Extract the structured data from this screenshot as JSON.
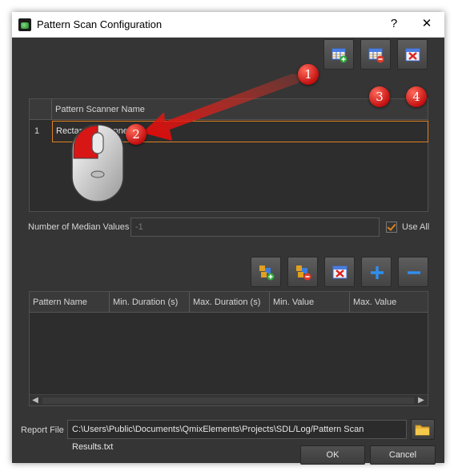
{
  "window": {
    "title": "Pattern Scan Configuration",
    "help_glyph": "?",
    "close_glyph": "✕"
  },
  "scanner_toolbar": [
    {
      "icon": "add-scanner-icon"
    },
    {
      "icon": "remove-scanner-icon"
    },
    {
      "icon": "clear-scanners-icon"
    }
  ],
  "scanner_table": {
    "column_header": "Pattern Scanner Name",
    "rows": [
      {
        "num": "1",
        "name": "Rectangle Scanner"
      }
    ]
  },
  "median": {
    "label": "Number of Median Values",
    "placeholder": "-1",
    "use_all_label": "Use All",
    "use_all_checked": true
  },
  "pattern_toolbar": [
    {
      "icon": "add-pattern-icon"
    },
    {
      "icon": "remove-pattern-icon"
    },
    {
      "icon": "clear-patterns-icon"
    },
    {
      "icon": "plus-icon"
    },
    {
      "icon": "minus-icon"
    }
  ],
  "pattern_table": {
    "headers": [
      "Pattern Name",
      "Min. Duration (s)",
      "Max. Duration (s)",
      "Min. Value",
      "Max. Value"
    ]
  },
  "report": {
    "label": "Report File",
    "path": "C:\\Users\\Public\\Documents\\QmixElements\\Projects\\SDL/Log/Pattern Scan Results.txt"
  },
  "buttons": {
    "ok": "OK",
    "cancel": "Cancel"
  },
  "annotations": {
    "badges": [
      "1",
      "2",
      "3",
      "4"
    ],
    "badge_color": "#d41414",
    "accent_color": "#e08020"
  }
}
